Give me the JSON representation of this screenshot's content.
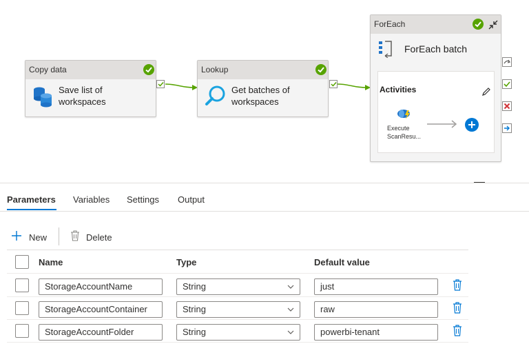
{
  "pipeline": {
    "nodes": {
      "copy_data": {
        "header": "Copy data",
        "line1": "Save list of",
        "line2": "workspaces",
        "status": "succeeded"
      },
      "lookup": {
        "header": "Lookup",
        "line1": "Get batches of",
        "line2": "workspaces",
        "status": "succeeded"
      },
      "foreach": {
        "header": "ForEach",
        "title": "ForEach batch",
        "status": "succeeded",
        "activities_label": "Activities",
        "inner_line1": "Execute",
        "inner_line2": "ScanResu..."
      }
    },
    "colors": {
      "success": "#57a300",
      "edge": "#57a300",
      "accent": "#0078d4",
      "fail": "#d13438"
    },
    "icons": [
      "database-icon",
      "magnifier-icon",
      "foreach-icon",
      "collapse-icon",
      "pencil-icon",
      "pipeline-icon",
      "add-icon"
    ]
  },
  "tabs": [
    {
      "label": "Parameters",
      "active": true
    },
    {
      "label": "Variables",
      "active": false
    },
    {
      "label": "Settings",
      "active": false
    },
    {
      "label": "Output",
      "active": false
    }
  ],
  "toolbar": {
    "new_label": "New",
    "delete_label": "Delete"
  },
  "table": {
    "headers": {
      "name": "Name",
      "type": "Type",
      "default": "Default value"
    },
    "rows": [
      {
        "name": "StorageAccountName",
        "type": "String",
        "default": "just"
      },
      {
        "name": "StorageAccountContainer",
        "type": "String",
        "default": "raw"
      },
      {
        "name": "StorageAccountFolder",
        "type": "String",
        "default": "powerbi-tenant"
      }
    ]
  }
}
